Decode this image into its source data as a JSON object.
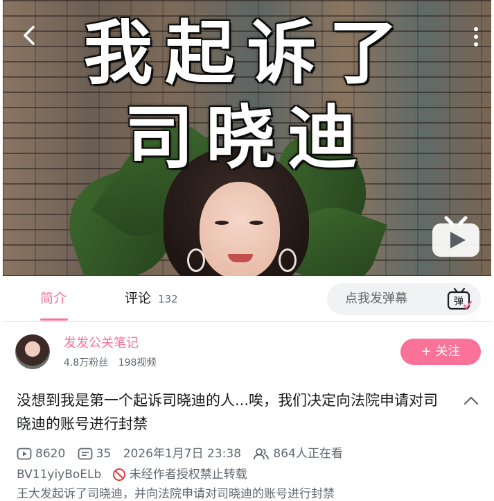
{
  "video": {
    "headline_line1": "我起诉了",
    "headline_line2": "司晓迪",
    "icons": [
      "back-icon",
      "more-icon",
      "play-icon"
    ]
  },
  "tabs": [
    {
      "label": "简介",
      "active": true
    },
    {
      "label": "评论",
      "count": "132",
      "active": false
    }
  ],
  "danmaku": {
    "placeholder": "点我发弹幕",
    "icon_label": "弹"
  },
  "uploader": {
    "name": "发发公关笔记",
    "followers": "4.8万粉丝",
    "videos": "198视频",
    "follow_label": "+ 关注"
  },
  "video_title": "没想到我是第一个起诉司晓迪的人...唉，我们决定向法院申请对司晓迪的账号进行封禁",
  "meta": {
    "plays": "8620",
    "danmaku_count": "35",
    "datetime": "2026年1月7日 23:38",
    "watching": "864人正在看",
    "bvid": "BV11yiyBoELb",
    "copyright_notice": "未经作者授权禁止转载"
  },
  "description": "王大发起诉了司晓迪，并向法院申请对司晓迪的账号进行封禁",
  "colors": {
    "accent": "#fb7299",
    "text_primary": "#18191c",
    "text_secondary": "#61666d",
    "warning": "#e23b3b",
    "input_bg": "#f1f2f3"
  }
}
